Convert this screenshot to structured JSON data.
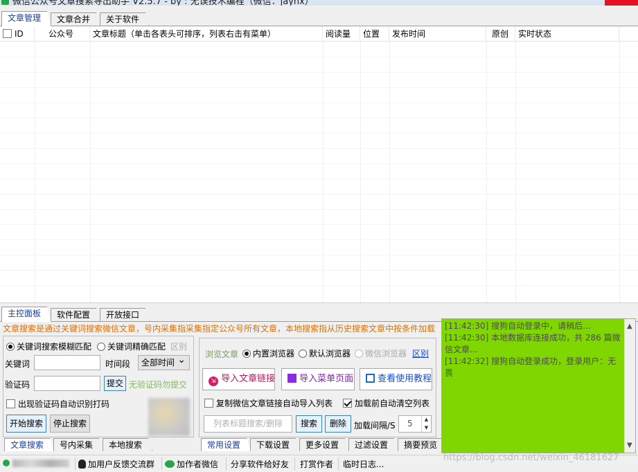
{
  "titlebar": {
    "title": "微信公众号文章搜索导出助手 V2.5.7 - by : 无误技术编程（微信：jayhx）"
  },
  "top_tabs": [
    "文章管理",
    "文章合并",
    "关于软件"
  ],
  "table": {
    "columns": [
      "ID",
      "公众号",
      "文章标题（单击各表头可排序，列表右击有菜单）",
      "阅读量",
      "位置",
      "发布时间",
      "原创",
      "实时状态"
    ]
  },
  "bottom_tabs": [
    "主控面板",
    "软件配置",
    "开放接口"
  ],
  "notice": "文章搜索是通过关键词搜索微信文章，号内采集指采集指定公众号所有文章，本地搜索指从历史搜索文章中按条件加载",
  "search_panel": {
    "radio_fuzzy": "关键词搜索模糊匹配",
    "radio_exact": "关键词精确匹配",
    "diff_link": "区别",
    "keyword_label": "关键词",
    "time_label": "时间段",
    "time_value": "全部时间",
    "captcha_label": "验证码",
    "submit_btn": "提交",
    "captcha_hint": "无验证码勿提交",
    "auto_captcha": "出现验证码自动识别打码",
    "start_btn": "开始搜索",
    "stop_btn": "停止搜索"
  },
  "search_tabs": [
    "文章搜索",
    "号内采集",
    "本地搜索"
  ],
  "browser_panel": {
    "label": "浏览文章",
    "radio_builtin": "内置浏览器",
    "radio_default": "默认浏览器",
    "radio_wechat": "微信浏览器",
    "diff_link": "区别",
    "import_links_btn": "导入文章链接",
    "import_menu_btn": "导入菜单页面",
    "tutorial_btn": "查看使用教程",
    "copy_auto_import": "复制微信文章链接自动导入列表",
    "clear_before_load": "加载前自动清空列表",
    "filter_placeholder": "列表标题搜索/删除",
    "search_btn": "搜索",
    "delete_btn": "删除",
    "interval_label": "加载间隔/S",
    "interval_value": "5"
  },
  "settings_tabs": [
    "常用设置",
    "下载设置",
    "更多设置",
    "过滤设置",
    "摘要预览"
  ],
  "log": {
    "lines": [
      "[11:42:30] 搜狗自动登录中，请稍后...",
      "[11:42:30] 本地数据库连接成功，共 286 篇微信文章...",
      "[11:42:32] 搜狗自动登录成功，登录用户：无畏"
    ]
  },
  "statusbar": {
    "feedback": "加用户反馈交流群",
    "add_wechat": "加作者微信",
    "share": "分享软件给好友",
    "reward": "打赏作者",
    "temp_log": "临时日志..."
  },
  "watermark": "https://blog.csdn.net/weixin_46181627",
  "colors": {
    "log_bg": "#7fd600",
    "notice": "#e07000",
    "accent_tab": "#1a3e9c"
  }
}
